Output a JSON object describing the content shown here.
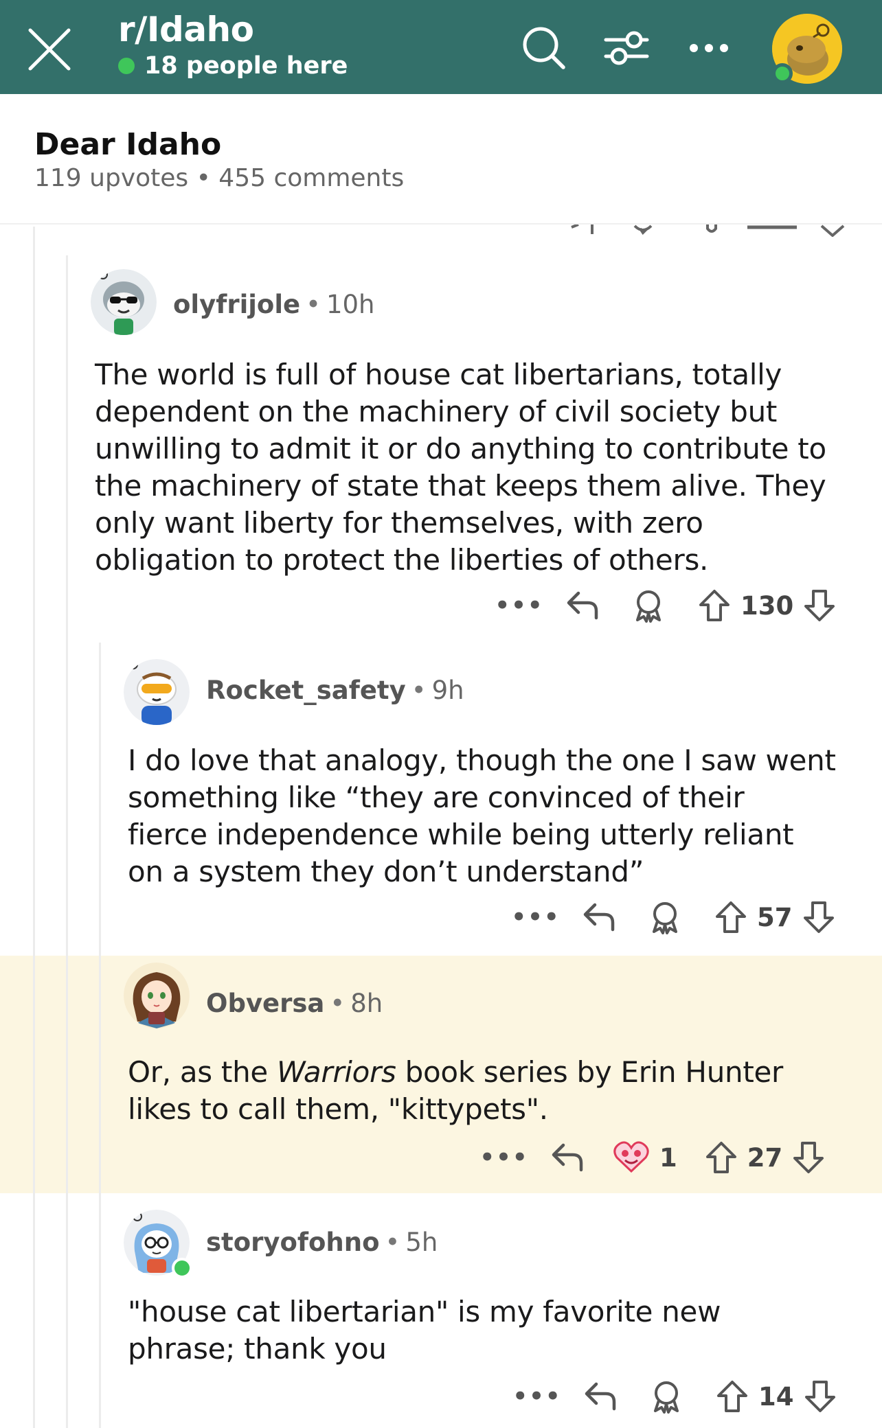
{
  "header": {
    "subreddit": "r/Idaho",
    "online_text": "18 people here",
    "colors": {
      "bar": "#33706a",
      "online": "#3fc65a",
      "avatar_bg": "#f5c623"
    }
  },
  "post": {
    "title": "Dear Idaho",
    "stats": "119 upvotes • 455 comments"
  },
  "comments": [
    {
      "user": "olyfrijole",
      "time": "10h",
      "avatar": "snoo-sunglasses-avatar",
      "lines": [
        "The world is full of house cat libertarians, totally",
        "dependent on the machinery of civil society but",
        "unwilling to admit it or do anything to contribute to",
        "the machinery of state that keeps them alive. They",
        "only want liberty for themselves, with zero",
        "obligation to protect the liberties of others."
      ],
      "votes": "130"
    },
    {
      "user": "Rocket_safety",
      "time": "9h",
      "avatar": "snoo-goggles-avatar",
      "lines": [
        "I do love that analogy, though the one I saw went",
        "something like “they are convinced of their",
        "fierce independence while being utterly reliant",
        "on a system they don’t understand”"
      ],
      "votes": "57"
    },
    {
      "user": "Obversa",
      "time": "8h",
      "avatar": "anime-girl-avatar",
      "line1_pre": "Or, as the ",
      "line1_italic": "Warriors",
      "line1_post": " book series by Erin Hunter",
      "line2": "likes to call them, \"kittypets\".",
      "award_count": "1",
      "votes": "27",
      "highlight": "#fcf6e1"
    },
    {
      "user": "storyofohno",
      "time": "5h",
      "avatar": "snoo-glasses-avatar",
      "lines": [
        "\"house cat libertarian\" is my favorite new",
        "phrase; thank you"
      ],
      "votes": "14"
    }
  ],
  "separator": "•",
  "more_glyph": "•••"
}
